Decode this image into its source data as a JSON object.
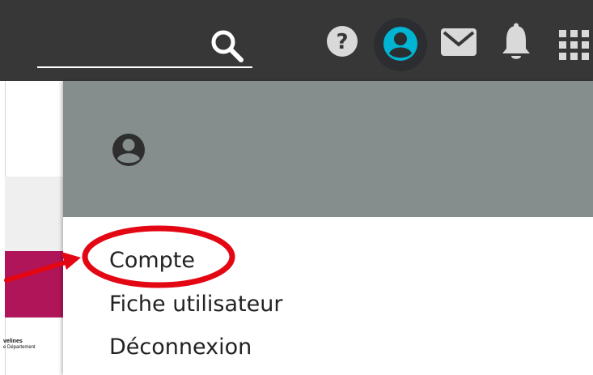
{
  "topbar": {
    "icons": {
      "search": "search-icon",
      "help": "help-icon",
      "user": "user-avatar-icon",
      "mail": "mail-icon",
      "bell": "bell-icon",
      "apps": "apps-grid-icon"
    },
    "colors": {
      "background": "#373737",
      "user_accent": "#00b5d3",
      "icon": "#d9d9d9"
    }
  },
  "left_page": {
    "logo_line1": "velines",
    "logo_line2": "e Département",
    "colors": {
      "accent": "#b0155a"
    }
  },
  "dropdown": {
    "header": {
      "avatar_icon": "user-avatar-icon",
      "color": "#868d8d"
    },
    "items": [
      {
        "label": "Compte"
      },
      {
        "label": "Fiche utilisateur"
      },
      {
        "label": "Déconnexion"
      }
    ]
  },
  "annotation": {
    "color": "#e30613"
  }
}
